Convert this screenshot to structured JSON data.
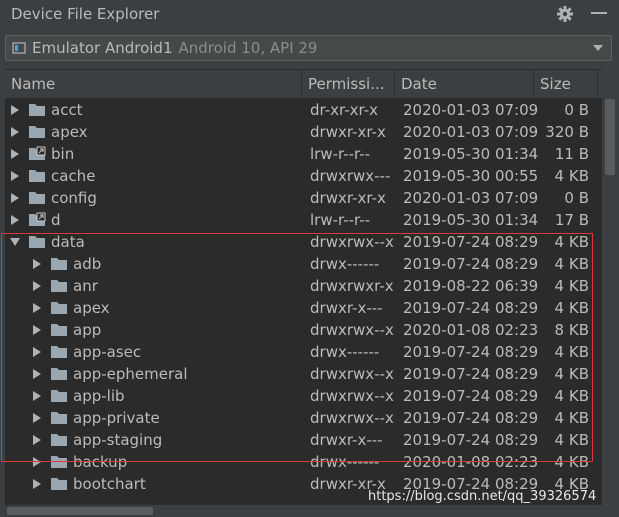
{
  "window": {
    "title": "Device File Explorer"
  },
  "device": {
    "name": "Emulator Android1",
    "api": "Android 10, API 29"
  },
  "columns": {
    "name": "Name",
    "permissions": "Permissi...",
    "date": "Date",
    "size": "Size"
  },
  "rows": [
    {
      "name": "acct",
      "perm": "dr-xr-xr-x",
      "date": "2020-01-03 07:09",
      "size": "0 B",
      "depth": 0,
      "expanded": false,
      "icon": "folder"
    },
    {
      "name": "apex",
      "perm": "drwxr-xr-x",
      "date": "2020-01-03 07:09",
      "size": "320 B",
      "depth": 0,
      "expanded": false,
      "icon": "folder"
    },
    {
      "name": "bin",
      "perm": "lrw-r--r--",
      "date": "2019-05-30 01:34",
      "size": "11 B",
      "depth": 0,
      "expanded": false,
      "icon": "link-folder"
    },
    {
      "name": "cache",
      "perm": "drwxrwx---",
      "date": "2019-05-30 00:55",
      "size": "4 KB",
      "depth": 0,
      "expanded": false,
      "icon": "folder"
    },
    {
      "name": "config",
      "perm": "drwxr-xr-x",
      "date": "2020-01-03 07:09",
      "size": "0 B",
      "depth": 0,
      "expanded": false,
      "icon": "folder"
    },
    {
      "name": "d",
      "perm": "lrw-r--r--",
      "date": "2019-05-30 01:34",
      "size": "17 B",
      "depth": 0,
      "expanded": false,
      "icon": "link-folder"
    },
    {
      "name": "data",
      "perm": "drwxrwx--x",
      "date": "2019-07-24 08:29",
      "size": "4 KB",
      "depth": 0,
      "expanded": true,
      "icon": "folder"
    },
    {
      "name": "adb",
      "perm": "drwx------",
      "date": "2019-07-24 08:29",
      "size": "4 KB",
      "depth": 1,
      "expanded": false,
      "icon": "folder"
    },
    {
      "name": "anr",
      "perm": "drwxrwxr-x",
      "date": "2019-08-22 06:39",
      "size": "4 KB",
      "depth": 1,
      "expanded": false,
      "icon": "folder"
    },
    {
      "name": "apex",
      "perm": "drwxr-x---",
      "date": "2019-07-24 08:29",
      "size": "4 KB",
      "depth": 1,
      "expanded": false,
      "icon": "folder"
    },
    {
      "name": "app",
      "perm": "drwxrwx--x",
      "date": "2020-01-08 02:23",
      "size": "8 KB",
      "depth": 1,
      "expanded": false,
      "icon": "folder"
    },
    {
      "name": "app-asec",
      "perm": "drwx------",
      "date": "2019-07-24 08:29",
      "size": "4 KB",
      "depth": 1,
      "expanded": false,
      "icon": "folder"
    },
    {
      "name": "app-ephemeral",
      "perm": "drwxrwx--x",
      "date": "2019-07-24 08:29",
      "size": "4 KB",
      "depth": 1,
      "expanded": false,
      "icon": "folder"
    },
    {
      "name": "app-lib",
      "perm": "drwxrwx--x",
      "date": "2019-07-24 08:29",
      "size": "4 KB",
      "depth": 1,
      "expanded": false,
      "icon": "folder"
    },
    {
      "name": "app-private",
      "perm": "drwxrwx--x",
      "date": "2019-07-24 08:29",
      "size": "4 KB",
      "depth": 1,
      "expanded": false,
      "icon": "folder"
    },
    {
      "name": "app-staging",
      "perm": "drwxr-x---",
      "date": "2019-07-24 08:29",
      "size": "4 KB",
      "depth": 1,
      "expanded": false,
      "icon": "folder"
    },
    {
      "name": "backup",
      "perm": "drwx------",
      "date": "2020-01-08 02:23",
      "size": "4 KB",
      "depth": 1,
      "expanded": false,
      "icon": "folder"
    },
    {
      "name": "bootchart",
      "perm": "drwxr-xr-x",
      "date": "2019-07-24 08:29",
      "size": "4 KB",
      "depth": 1,
      "expanded": false,
      "icon": "folder"
    }
  ],
  "watermark": "https://blog.csdn.net/qq_39326574"
}
